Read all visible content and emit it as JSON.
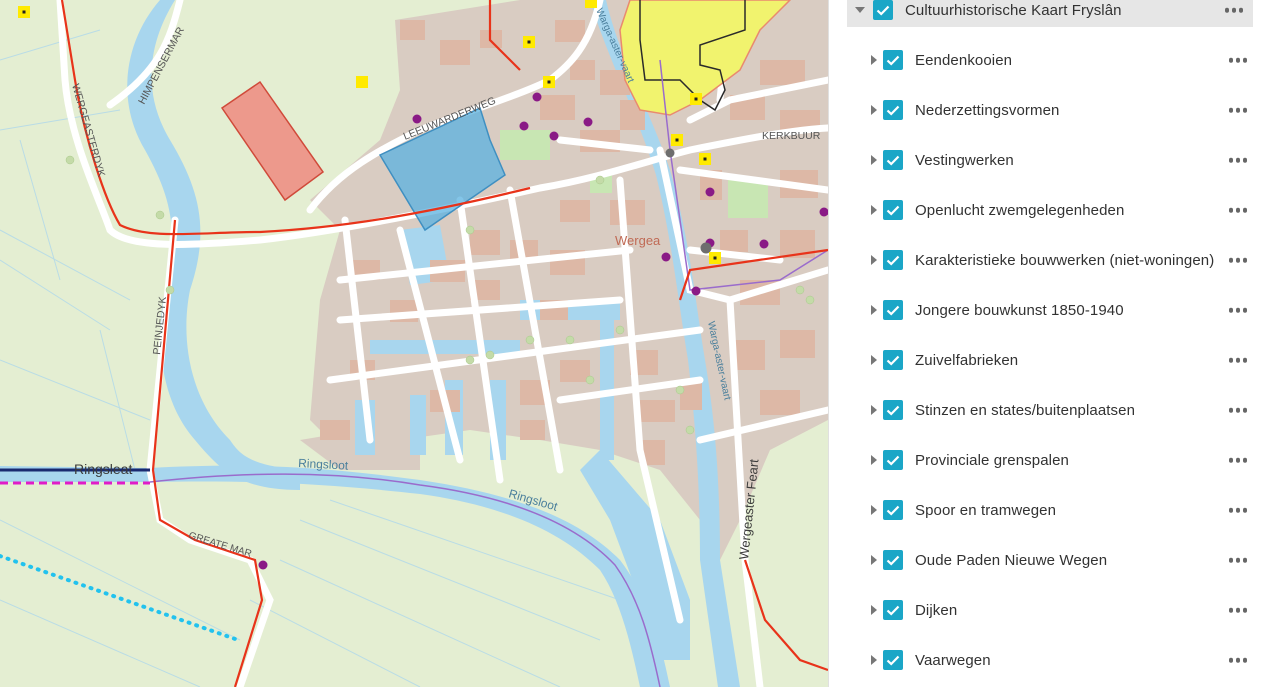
{
  "map": {
    "labels": {
      "town": "Wergea",
      "leeuwarderweg": "LEEUWARDERWEG",
      "kerkbuurt": "KERKBUUR",
      "wergeasterdyk": "WERGEASTERDYK",
      "himpensermar": "HIMPENSERMAR",
      "peinjedyk": "PEINJEDYK",
      "ringsleat": "Ringsleat",
      "ringsloot1": "Ringsloot",
      "ringsloot2": "Ringsloot",
      "greatemar": "GREATE MAR",
      "wargaasteryaart_n": "Warga-aster-vaart",
      "wargaasteryaart_s": "Warga-aster-vaart",
      "wergeaster_feart": "Wergeaster Feart"
    },
    "colors": {
      "land": "#e4eed2",
      "built": "#d9ccc2",
      "building": "#ddb8a6",
      "water": "#a8d6ee",
      "road": "#ffffff",
      "red_route": "#e8331a",
      "purple_boundary": "#9a6ccc",
      "yellow_area": "#f1f36e",
      "blue_area": "#59b1e0",
      "red_area": "#ef8a80",
      "point_purple": "#8a1a86",
      "point_yellow": "#ffea00",
      "cyan_dots": "#22c2ee",
      "magenta_dash": "#e01cc8",
      "navy_line": "#1a2a70"
    }
  },
  "panel": {
    "group_label": "Cultuurhistorische Kaart Fryslân",
    "layers": [
      {
        "label": "Eendenkooien"
      },
      {
        "label": "Nederzettingsvormen"
      },
      {
        "label": "Vestingwerken"
      },
      {
        "label": "Openlucht zwemgelegenheden"
      },
      {
        "label": "Karakteristieke bouwwerken (niet-woningen)"
      },
      {
        "label": "Jongere bouwkunst 1850-1940"
      },
      {
        "label": "Zuivelfabrieken"
      },
      {
        "label": "Stinzen en states/buitenplaatsen"
      },
      {
        "label": "Provinciale grenspalen"
      },
      {
        "label": "Spoor en tramwegen"
      },
      {
        "label": "Oude Paden Nieuwe Wegen"
      },
      {
        "label": "Dijken"
      },
      {
        "label": "Vaarwegen"
      }
    ]
  }
}
